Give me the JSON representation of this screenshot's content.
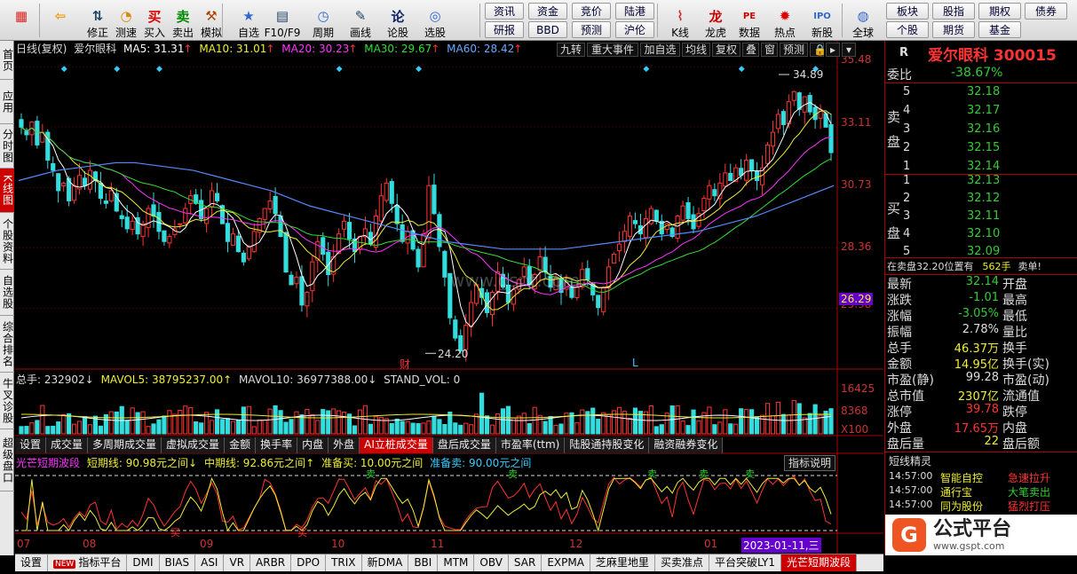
{
  "toolbar": {
    "buttons": [
      {
        "label": "",
        "icon": "windows-icon",
        "x": 6
      },
      {
        "label": "",
        "icon": "back-arrow-icon",
        "x": 50
      },
      {
        "label": "修正",
        "icon": "up-down-arrow-icon",
        "x": 92
      },
      {
        "label": "测速",
        "icon": "speed-icon",
        "x": 124
      },
      {
        "label": "买入",
        "icon": "buy-icon",
        "x": 156
      },
      {
        "label": "卖出",
        "icon": "sell-icon",
        "x": 188
      },
      {
        "label": "模拟",
        "icon": "hammer-icon",
        "x": 220
      },
      {
        "label": "自选",
        "icon": "star-folder-icon",
        "x": 262
      },
      {
        "label": "F10/F9",
        "icon": "f10-icon",
        "x": 300
      },
      {
        "label": "周期",
        "icon": "clock-icon",
        "x": 346
      },
      {
        "label": "画线",
        "icon": "pencil-icon",
        "x": 388
      },
      {
        "label": "论股",
        "icon": "discuss-icon",
        "x": 430
      },
      {
        "label": "选股",
        "icon": "magnifier-chart-icon",
        "x": 472
      }
    ],
    "grid_buttons": [
      [
        "资讯",
        "资金",
        "竞价",
        "陆港"
      ],
      [
        "研报",
        "BBD",
        "预测",
        "沪伦"
      ]
    ],
    "right_buttons": [
      {
        "label": "K线",
        "icon": "kline-icon",
        "x": 748
      },
      {
        "label": "龙虎",
        "icon": "dragon-icon",
        "x": 788
      },
      {
        "label": "数据",
        "icon": "pe-icon",
        "x": 826
      },
      {
        "label": "热点",
        "icon": "hot-icon",
        "x": 866
      },
      {
        "label": "新股",
        "icon": "ipo-icon",
        "x": 908
      },
      {
        "label": "全球",
        "icon": "globe-icon",
        "x": 954
      }
    ],
    "grid2": [
      [
        "板块",
        "股指",
        "期权",
        "债券"
      ],
      [
        "个股",
        "期货",
        "基金",
        ""
      ]
    ]
  },
  "left_tabs": [
    {
      "label": "首页",
      "h": 44,
      "active": false
    },
    {
      "label": "应用",
      "h": 50,
      "active": false
    },
    {
      "label": "分时图",
      "h": 50,
      "active": false
    },
    {
      "label": "K线图",
      "h": 50,
      "active": true
    },
    {
      "label": "个股资料",
      "h": 64,
      "active": false
    },
    {
      "label": "自选股",
      "h": 52,
      "active": false
    },
    {
      "label": "综合排名",
      "h": 64,
      "active": false
    },
    {
      "label": "牛叉诊股",
      "h": 64,
      "active": false
    },
    {
      "label": "超级盘口",
      "h": 70,
      "active": false
    }
  ],
  "chart_header": {
    "period": "日线(复权)",
    "name": "爱尔眼科",
    "ma5": "MA5: 31.31",
    "ma10": "MA10: 31.01",
    "ma20": "MA20: 30.23",
    "ma30": "MA30: 29.67",
    "ma60": "MA60: 28.42",
    "tools": [
      "九转",
      "重大事件",
      "加自选",
      "均线",
      "复权",
      "叠",
      "窗",
      "预测"
    ]
  },
  "price_axis": [
    "35.48",
    "33.11",
    "30.73",
    "28.36",
    "25.98"
  ],
  "price_marker": "26.29",
  "annotations": {
    "high": "34.89",
    "low": "24.20",
    "fin": "财",
    "L": "L",
    "watermark": "www.gspt.com"
  },
  "volume": {
    "header": [
      "总手: 232902↓",
      "MAVOL5: 38795237.00↑",
      "MAVOL10: 36977388.00↓",
      "STAND_VOL: 0"
    ],
    "axis": [
      "16425",
      "8368",
      "X100"
    ]
  },
  "mid_tabs": [
    "设置",
    "成交量",
    "多周期成交量",
    "虚拟成交量",
    "金额",
    "换手率",
    "内盘",
    "外盘",
    "AI立桩成交量",
    "盘后成交量",
    "市盈率(ttm)",
    "陆股通持股变化",
    "融资融券变化"
  ],
  "indicator": {
    "header": [
      "光芒短期波段",
      "短期线: 90.98元之间↓",
      "中期线: 92.86元之间↑",
      "准备买: 10.00元之间",
      "准备卖: 90.00元之间"
    ],
    "button": "指标说明",
    "sell": "卖",
    "buy": "买"
  },
  "x_axis": [
    "07",
    "08",
    "09",
    "10",
    "11",
    "12",
    "01"
  ],
  "date_tag": "2023-01-11,三",
  "bottom_tabs": [
    "设置",
    "指标平台",
    "DMI",
    "BIAS",
    "ASI",
    "VR",
    "ARBR",
    "DPO",
    "TRIX",
    "新DMA",
    "BBI",
    "MTM",
    "OBV",
    "SAR",
    "EXPMA",
    "芝麻里地里",
    "买卖准点",
    "平台突破LY1",
    "光芒短期波段"
  ],
  "new_badge": "NEW",
  "right": {
    "R": "R",
    "title": "爱尔眼科 300015",
    "weibi_label": "委比",
    "weibi": "-38.67%",
    "sell_label": "卖盘",
    "buy_label": "买盘",
    "asks": [
      [
        "5",
        "32.18"
      ],
      [
        "4",
        "32.17"
      ],
      [
        "3",
        "32.16"
      ],
      [
        "2",
        "32.15"
      ],
      [
        "1",
        "32.14"
      ]
    ],
    "bids": [
      [
        "1",
        "32.13"
      ],
      [
        "2",
        "32.12"
      ],
      [
        "3",
        "32.11"
      ],
      [
        "4",
        "32.10"
      ],
      [
        "5",
        "32.09"
      ]
    ],
    "notice": "在卖盘32.20位置有",
    "notice_qty": "562手",
    "notice_tag": "卖单!",
    "quotes": [
      [
        "最新",
        "32.14",
        "开盘"
      ],
      [
        "涨跌",
        "-1.01",
        "最高"
      ],
      [
        "涨幅",
        "-3.05%",
        "最低"
      ],
      [
        "振幅",
        "2.78%",
        "量比"
      ],
      [
        "总手",
        "46.37万",
        "换手"
      ],
      [
        "金额",
        "14.95亿",
        "换手(实)"
      ],
      [
        "市盈(静)",
        "99.28",
        "市盈(动)"
      ],
      [
        "总市值",
        "2307亿",
        "流通值"
      ],
      [
        "涨停",
        "39.78",
        "跌停"
      ],
      [
        "外盘",
        "17.65万",
        "内盘"
      ],
      [
        "盘后量",
        "22",
        "盘后额"
      ]
    ],
    "short_title": "短线精灵",
    "short": [
      [
        "14:57:00",
        "智能自控",
        "急速拉升"
      ],
      [
        "14:57:00",
        "通行宝",
        "大笔卖出"
      ],
      [
        "14:57:00",
        "同为股份",
        "猛烈打压"
      ]
    ],
    "brand": "公式平台",
    "brand_url": "www.gspt.com"
  },
  "chart_data": {
    "type": "candlestick",
    "ylim": [
      24.0,
      35.8
    ],
    "seed": "approx",
    "closes": [
      33.1,
      32.8,
      33.3,
      32.4,
      32.9,
      31.8,
      31.4,
      30.6,
      30.9,
      30.2,
      30.8,
      31.2,
      30.8,
      31.4,
      31.0,
      30.3,
      30.1,
      30.6,
      29.8,
      29.5,
      29.1,
      29.4,
      28.9,
      29.3,
      29.9,
      29.6,
      29.0,
      28.6,
      28.8,
      29.1,
      29.3,
      29.9,
      30.4,
      30.1,
      29.5,
      29.9,
      30.6,
      30.2,
      29.3,
      28.6,
      28.9,
      28.2,
      27.8,
      28.4,
      29.0,
      29.5,
      29.9,
      30.2,
      29.7,
      28.8,
      27.4,
      26.9,
      27.2,
      26.1,
      26.6,
      27.8,
      28.6,
      28.1,
      27.3,
      28.0,
      28.9,
      29.4,
      28.7,
      28.2,
      28.8,
      29.1,
      28.5,
      29.6,
      30.4,
      30.9,
      30.1,
      29.3,
      28.6,
      29.0,
      28.3,
      27.6,
      28.9,
      30.8,
      29.7,
      28.4,
      27.2,
      25.6,
      24.8,
      24.3,
      25.3,
      26.2,
      26.9,
      26.4,
      25.8,
      26.6,
      27.4,
      26.8,
      26.2,
      26.7,
      27.1,
      27.6,
      26.9,
      27.3,
      28.0,
      27.4,
      26.8,
      27.2,
      26.6,
      27.0,
      26.4,
      26.8,
      27.5,
      27.1,
      26.5,
      26.0,
      26.8,
      27.6,
      28.1,
      28.5,
      29.0,
      29.6,
      29.3,
      28.9,
      29.5,
      29.9,
      29.4,
      28.9,
      29.3,
      28.8,
      29.6,
      30.0,
      29.5,
      29.1,
      29.7,
      30.3,
      30.8,
      30.4,
      30.9,
      31.3,
      31.0,
      31.5,
      31.2,
      31.8,
      31.4,
      31.0,
      31.5,
      32.4,
      32.9,
      33.6,
      33.2,
      34.1,
      34.5,
      33.8,
      34.3,
      33.7,
      33.4,
      33.8,
      33.1,
      32.1
    ],
    "ma60": [
      31.0,
      31.2,
      31.4,
      31.5,
      31.6,
      31.7,
      31.7,
      31.6,
      31.5,
      31.4,
      31.2,
      31.0,
      30.8,
      30.6,
      30.3,
      30.0,
      29.8,
      29.6,
      29.4,
      29.2,
      29.0,
      28.8,
      28.6,
      28.5,
      28.4,
      28.3,
      28.3,
      28.3,
      28.3,
      28.4,
      28.5,
      28.6,
      28.7,
      28.8,
      28.9,
      29.0,
      29.2,
      29.4,
      29.6,
      29.9,
      30.2,
      30.5,
      30.8
    ]
  }
}
